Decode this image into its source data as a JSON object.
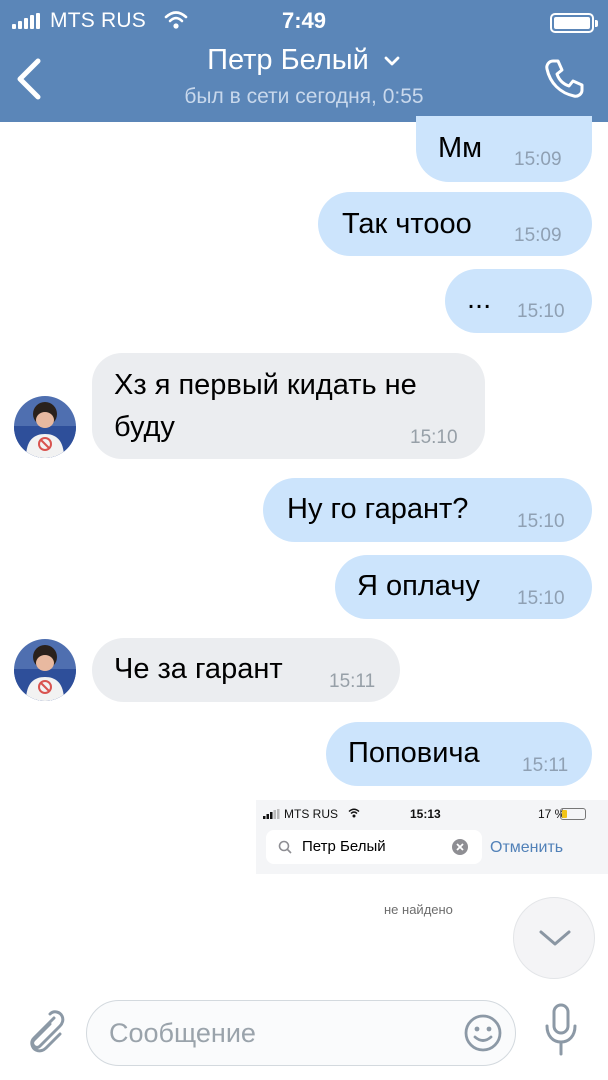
{
  "status_bar": {
    "carrier": "MTS RUS",
    "time": "7:49"
  },
  "header": {
    "title": "Петр Белый",
    "subtitle": "был в сети сегодня, 0:55"
  },
  "messages": [
    {
      "dir": "out",
      "text": "Мм",
      "time": "15:09"
    },
    {
      "dir": "out",
      "text": "Так чтооо",
      "time": "15:09"
    },
    {
      "dir": "out",
      "text": "...",
      "time": "15:10"
    },
    {
      "dir": "in",
      "text_line1": "Хз я первый кидать не",
      "text_line2": "буду",
      "time": "15:10"
    },
    {
      "dir": "out",
      "text": "Ну го гарант?",
      "time": "15:10"
    },
    {
      "dir": "out",
      "text": "Я оплачу",
      "time": "15:10"
    },
    {
      "dir": "in",
      "text": "Че за гарант",
      "time": "15:11"
    },
    {
      "dir": "out",
      "text": "Поповича",
      "time": "15:11"
    }
  ],
  "attached_screenshot": {
    "carrier": "MTS RUS",
    "time": "15:13",
    "battery": "17 %",
    "search_value": "Петр Белый",
    "cancel_label": "Отменить",
    "not_found": "не найдено"
  },
  "composer": {
    "placeholder": "Сообщение"
  },
  "colors": {
    "header_bg": "#5b86b8",
    "outgoing_bubble": "#cce4fc",
    "incoming_bubble": "#ebedf0",
    "link": "#5181b8"
  },
  "icons": [
    "signal-icon",
    "wifi-icon",
    "battery-icon",
    "back-chevron-icon",
    "chevron-down-icon",
    "phone-icon",
    "avatar",
    "search-icon",
    "clear-icon",
    "scroll-down-icon",
    "paperclip-icon",
    "smile-icon",
    "microphone-icon"
  ]
}
